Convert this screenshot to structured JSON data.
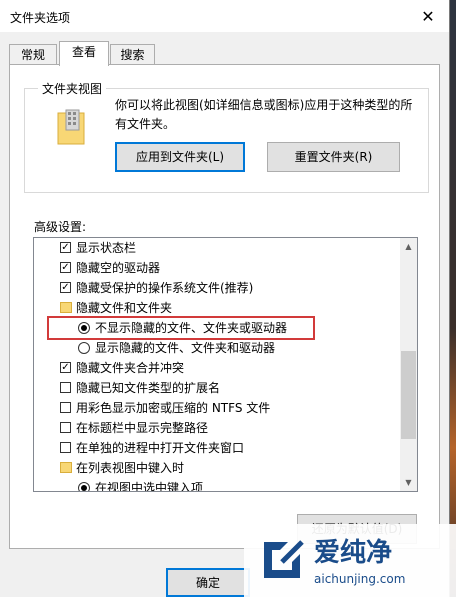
{
  "window": {
    "title": "文件夹选项"
  },
  "tabs": [
    {
      "label": "常规"
    },
    {
      "label": "查看"
    },
    {
      "label": "搜索"
    }
  ],
  "folder_views": {
    "caption": "文件夹视图",
    "description": "你可以将此视图(如详细信息或图标)应用于这种类型的所有文件夹。",
    "apply_button": "应用到文件夹(L)",
    "reset_button": "重置文件夹(R)"
  },
  "advanced": {
    "label": "高级设置:",
    "items": [
      {
        "type": "checkbox",
        "checked": true,
        "label": "显示状态栏"
      },
      {
        "type": "checkbox",
        "checked": true,
        "label": "隐藏空的驱动器"
      },
      {
        "type": "checkbox",
        "checked": true,
        "label": "隐藏受保护的操作系统文件(推荐)"
      },
      {
        "type": "folder",
        "label": "隐藏文件和文件夹"
      },
      {
        "type": "radio",
        "checked": true,
        "label": "不显示隐藏的文件、文件夹或驱动器"
      },
      {
        "type": "radio",
        "checked": false,
        "label": "显示隐藏的文件、文件夹和驱动器"
      },
      {
        "type": "checkbox",
        "checked": true,
        "label": "隐藏文件夹合并冲突"
      },
      {
        "type": "checkbox",
        "checked": false,
        "label": "隐藏已知文件类型的扩展名"
      },
      {
        "type": "checkbox",
        "checked": false,
        "label": "用彩色显示加密或压缩的 NTFS 文件"
      },
      {
        "type": "checkbox",
        "checked": false,
        "label": "在标题栏中显示完整路径"
      },
      {
        "type": "checkbox",
        "checked": false,
        "label": "在单独的进程中打开文件夹窗口"
      },
      {
        "type": "folder",
        "label": "在列表视图中键入时"
      },
      {
        "type": "radio",
        "checked": true,
        "label": "在视图中选中键入项"
      }
    ],
    "restore_button": "还原为默认值(D)"
  },
  "footer": {
    "ok_button": "确定"
  },
  "watermark": {
    "brand": "爱纯净",
    "url": "aichunjing.com"
  }
}
